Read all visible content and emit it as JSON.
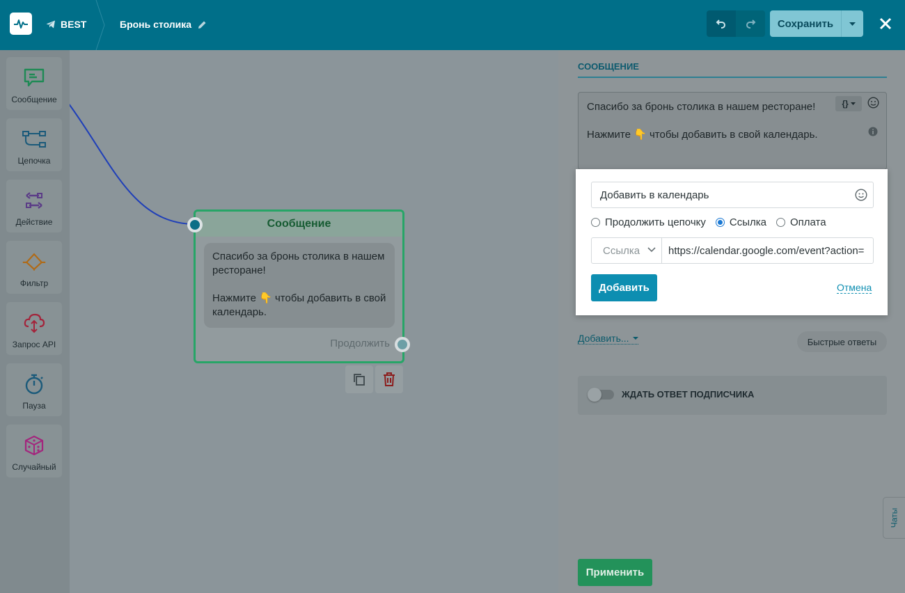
{
  "header": {
    "bot_name": "BEST",
    "flow_name": "Бронь столика",
    "save_label": "Сохранить"
  },
  "palette": {
    "items": [
      {
        "label": "Сообщение",
        "icon": "message-icon",
        "color": "#1f8a55"
      },
      {
        "label": "Цепочка",
        "icon": "chain-icon",
        "color": "#1b5a7a"
      },
      {
        "label": "Действие",
        "icon": "action-icon",
        "color": "#5b3c87"
      },
      {
        "label": "Фильтр",
        "icon": "filter-icon",
        "color": "#b06a16"
      },
      {
        "label": "Запрос API",
        "icon": "api-request-icon",
        "color": "#a3243b"
      },
      {
        "label": "Пауза",
        "icon": "timer-icon",
        "color": "#1b5a7a"
      },
      {
        "label": "Случайный",
        "icon": "dice-icon",
        "color": "#a3267d"
      }
    ]
  },
  "node": {
    "title": "Сообщение",
    "text_line1": "Спасибо за бронь столика в нашем ресторане!",
    "text_line2": "Нажмите 👇 чтобы добавить в свой календарь.",
    "continue_label": "Продолжить"
  },
  "panel": {
    "section_title": "СООБЩЕНИЕ",
    "message_line1": "Спасибо за бронь столика в нашем ресторане!",
    "message_line2": "Нажмите 👇 чтобы добавить в свой календарь.",
    "add_more_label": "Добавить...",
    "quick_replies_label": "Быстрые ответы",
    "wait_label": "ЖДАТЬ ОТВЕТ ПОДПИСЧИКА",
    "apply_label": "Применить",
    "chats_label": "Чаты"
  },
  "popup": {
    "button_text": "Добавить в календарь",
    "radio_options": [
      "Продолжить цепочку",
      "Ссылка",
      "Оплата"
    ],
    "selected_option": "Ссылка",
    "type_select": "Ссылка",
    "url_value": "https://calendar.google.com/event?action=",
    "add_label": "Добавить",
    "cancel_label": "Отмена"
  },
  "colors": {
    "header_bg": "#006f89",
    "node_border": "#27a567",
    "primary_button": "#0d8eb1",
    "apply_button": "#23925a"
  }
}
